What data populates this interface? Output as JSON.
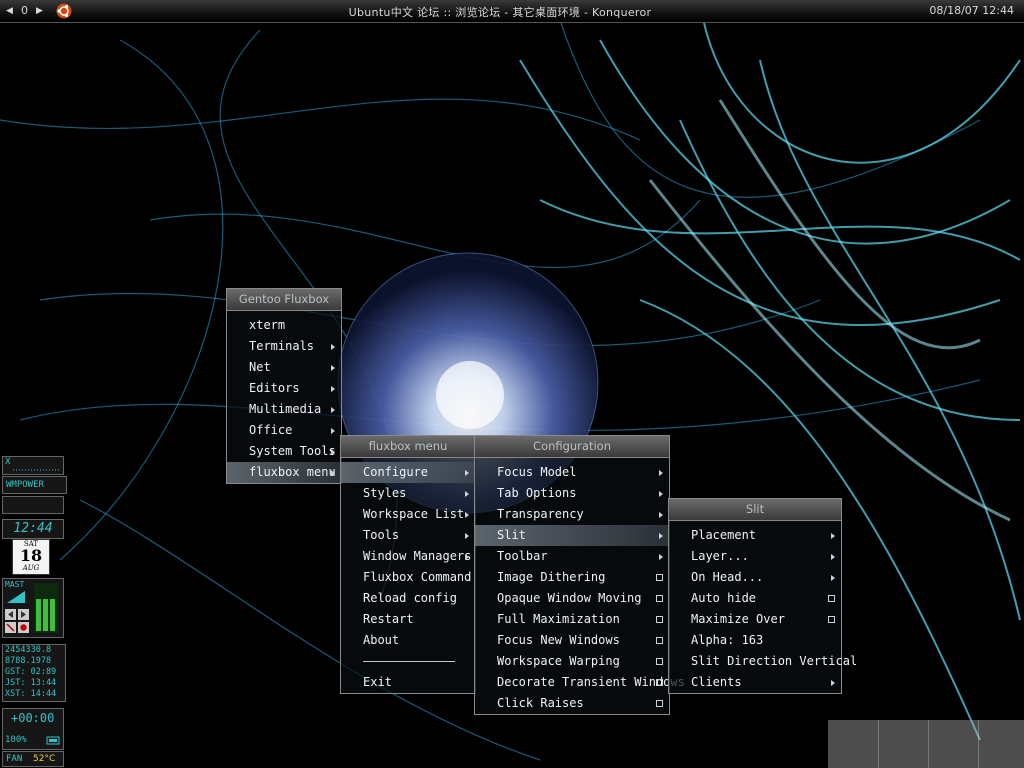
{
  "toolbar": {
    "prev_icon": "left-triangle-icon",
    "workspace": "0",
    "next_icon": "right-triangle-icon",
    "logo_icon": "ubuntu-logo-icon",
    "window_title": "Ubuntu中文 论坛 :: 浏览论坛 - 其它桌面环境 - Konqueror",
    "clock": "08/18/07 12:44"
  },
  "root_menu": {
    "title": "Gentoo Fluxbox",
    "items": [
      {
        "label": "xterm"
      },
      {
        "label": "Terminals"
      },
      {
        "label": "Net"
      },
      {
        "label": "Editors"
      },
      {
        "label": "Multimedia"
      },
      {
        "label": "Office"
      },
      {
        "label": "System Tools"
      },
      {
        "label": "fluxbox menu"
      }
    ]
  },
  "fluxbox_menu": {
    "title": "fluxbox menu",
    "items": [
      {
        "label": "Configure"
      },
      {
        "label": "Styles"
      },
      {
        "label": "Workspace List"
      },
      {
        "label": "Tools"
      },
      {
        "label": "Window Managers"
      },
      {
        "label": "Fluxbox Command"
      },
      {
        "label": "Reload config"
      },
      {
        "label": "Restart"
      },
      {
        "label": "About"
      },
      {
        "label": "Exit"
      }
    ]
  },
  "config_menu": {
    "title": "Configuration",
    "items": [
      {
        "label": "Focus Model"
      },
      {
        "label": "Tab Options"
      },
      {
        "label": "Transparency"
      },
      {
        "label": "Slit"
      },
      {
        "label": "Toolbar"
      },
      {
        "label": "Image Dithering"
      },
      {
        "label": "Opaque Window Moving"
      },
      {
        "label": "Full Maximization"
      },
      {
        "label": "Focus New Windows"
      },
      {
        "label": "Workspace Warping"
      },
      {
        "label": "Decorate Transient Windows"
      },
      {
        "label": "Click Raises"
      }
    ]
  },
  "slit_menu": {
    "title": "Slit",
    "items": [
      {
        "label": "Placement"
      },
      {
        "label": "Layer..."
      },
      {
        "label": "On Head..."
      },
      {
        "label": "Auto hide"
      },
      {
        "label": "Maximize Over"
      },
      {
        "label": "Alpha: 163"
      },
      {
        "label": "Slit Direction Vertical"
      },
      {
        "label": "Clients"
      }
    ]
  },
  "dock": {
    "x_label": "X",
    "wmpower": "WMPOWER",
    "clock": "12:44",
    "cal_day": "SAT",
    "cal_date": "18",
    "cal_month": "AUG",
    "mixer_label": "MAST",
    "stats": [
      "2454330.8",
      "8788.1978",
      "GST: 02:89",
      "JST: 13:44",
      "XST: 14:44"
    ],
    "batt_time": "+00:00",
    "batt_pct": "100%",
    "fan_label": "FAN",
    "fan_temp": "52°C"
  },
  "colors": {
    "lcd": "#2fc5c6",
    "menu_highlight": "#7a848c",
    "wallpaper_glow": "#4fd8f0"
  }
}
